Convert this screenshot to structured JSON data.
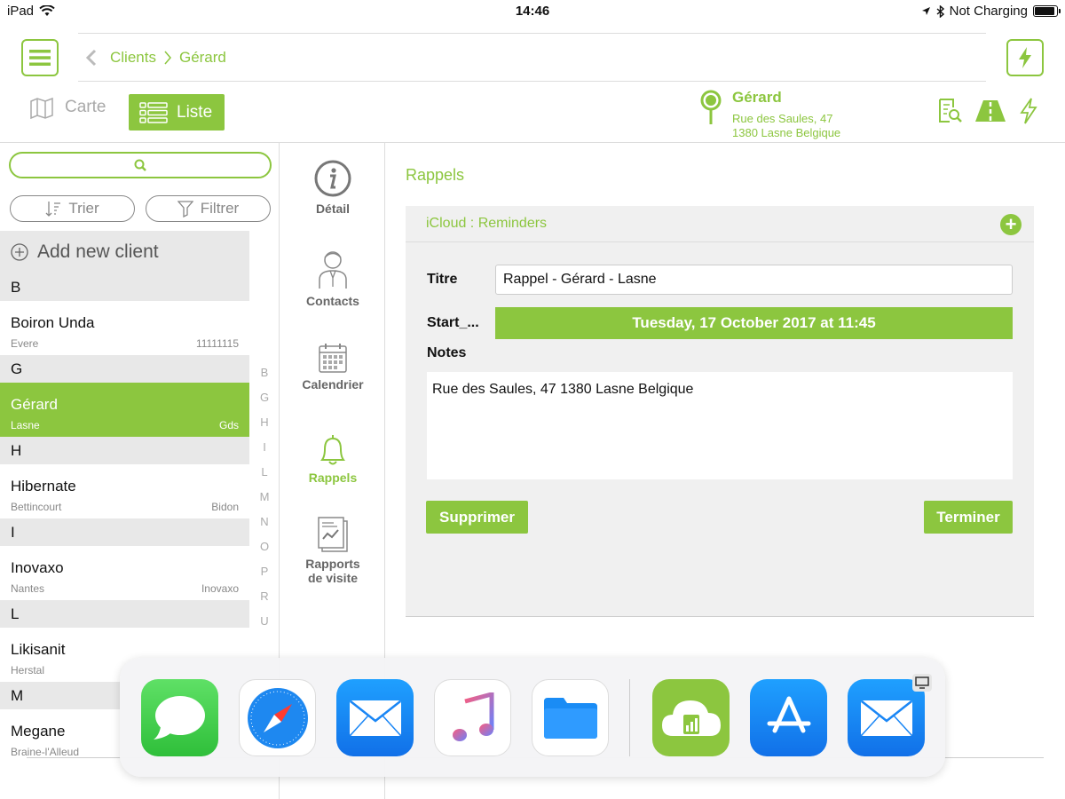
{
  "status_bar": {
    "device": "iPad",
    "time": "14:46",
    "charging": "Not Charging"
  },
  "nav": {
    "breadcrumb": [
      "Clients",
      "Gérard"
    ]
  },
  "view_toggle": {
    "map_label": "Carte",
    "list_label": "Liste",
    "active": "Liste"
  },
  "selected_client": {
    "name": "Gérard",
    "address_line1": "Rue des Saules, 47",
    "address_line2": "1380 Lasne  Belgique"
  },
  "sidebar": {
    "search_placeholder": "",
    "sort_label": "Trier",
    "filter_label": "Filtrer",
    "add_client_label": "Add new client",
    "sections": [
      {
        "letter": "B",
        "clients": [
          {
            "name": "Boiron Unda",
            "city": "Evere",
            "code": "11111115"
          }
        ]
      },
      {
        "letter": "G",
        "clients": [
          {
            "name": "Gérard",
            "city": "Lasne",
            "code": "Gds",
            "selected": true
          }
        ]
      },
      {
        "letter": "H",
        "clients": [
          {
            "name": "Hibernate",
            "city": "Bettincourt",
            "code": "Bidon"
          }
        ]
      },
      {
        "letter": "I",
        "clients": [
          {
            "name": "Inovaxo",
            "city": "Nantes",
            "code": "Inovaxo"
          }
        ]
      },
      {
        "letter": "L",
        "clients": [
          {
            "name": "Likisanit",
            "city": "Herstal",
            "code": ""
          }
        ]
      },
      {
        "letter": "M",
        "clients": [
          {
            "name": "Megane",
            "city": "Braine-l'Alleud",
            "code": ""
          }
        ]
      }
    ],
    "index_letters": [
      "B",
      "G",
      "H",
      "I",
      "L",
      "M",
      "N",
      "O",
      "P",
      "R",
      "U"
    ]
  },
  "tabs": [
    {
      "label": "Détail",
      "icon": "info-icon"
    },
    {
      "label": "Contacts",
      "icon": "person-icon"
    },
    {
      "label": "Calendrier",
      "icon": "calendar-icon"
    },
    {
      "label": "Rappels",
      "icon": "bell-icon",
      "active": true
    },
    {
      "label": "Rapports de visite",
      "icon": "report-icon"
    }
  ],
  "reminder": {
    "section_title": "Rappels",
    "source": "iCloud : Reminders",
    "title_label": "Titre",
    "title_value": "Rappel - Gérard - Lasne",
    "start_label": "Start_...",
    "start_value": "Tuesday, 17 October 2017 at 11:45",
    "notes_label": "Notes",
    "notes_value": "Rue des Saules, 47 1380 Lasne Belgique",
    "delete_label": "Supprimer",
    "done_label": "Terminer"
  },
  "dock": [
    "Messages",
    "Safari",
    "Mail",
    "Music",
    "Files",
    "Sales app",
    "App Store",
    "Mail"
  ],
  "colors": {
    "accent": "#8cc63f",
    "section_bg": "#e8e8e8"
  }
}
